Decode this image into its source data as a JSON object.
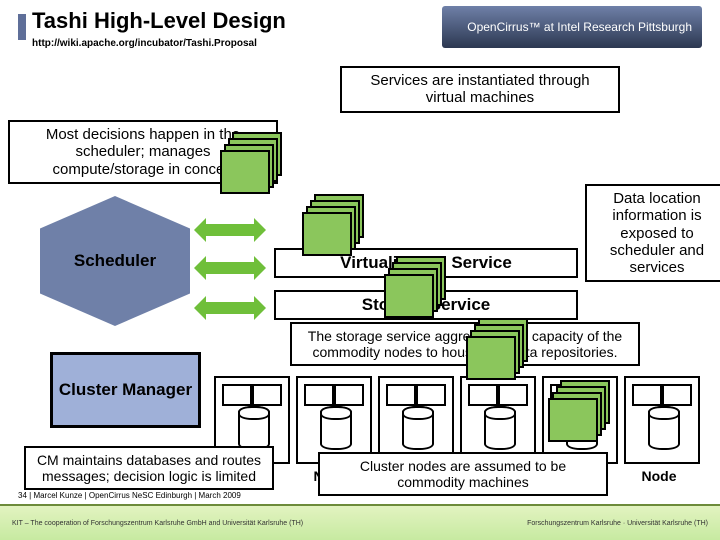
{
  "header": {
    "title": "Tashi High-Level Design",
    "subtitle_url": "http://wiki.apache.org/incubator/Tashi.Proposal",
    "logo_html": "OpenCirrus™ at Intel Research Pittsburgh"
  },
  "callouts": {
    "decisions": "Most decisions happen in the scheduler; manages compute/storage in concert",
    "vm": "Services are instantiated through virtual machines",
    "dataloc": "Data location information is exposed to scheduler and services",
    "storage_aggr": "The storage service aggregates the capacity of the commodity nodes to house Big Data repositories.",
    "cm": "CM maintains databases and routes messages; decision logic is limited",
    "commodity": "Cluster nodes are assumed to be commodity machines"
  },
  "blocks": {
    "scheduler": "Scheduler",
    "cluster_manager": "Cluster Manager"
  },
  "services": {
    "virt": "Virtualization Service",
    "storage": "Storage Service"
  },
  "node_label": "Node",
  "colors": {
    "hex": "#6f80a8",
    "cluster": "#9fb0d8",
    "vm": "#8bc65c",
    "arrow": "#6fbf3a",
    "title_bullet": "#5f6f99"
  },
  "meta": {
    "page_number": "34",
    "line": "| Marcel Kunze | OpenCirrus NeSC Edinburgh | March 2009",
    "footer_text": "KIT – The cooperation of Forschungszentrum Karlsruhe GmbH and Universität Karlsruhe (TH)",
    "footer_right": "Forschungszentrum Karlsruhe · Universität Karlsruhe (TH)"
  }
}
